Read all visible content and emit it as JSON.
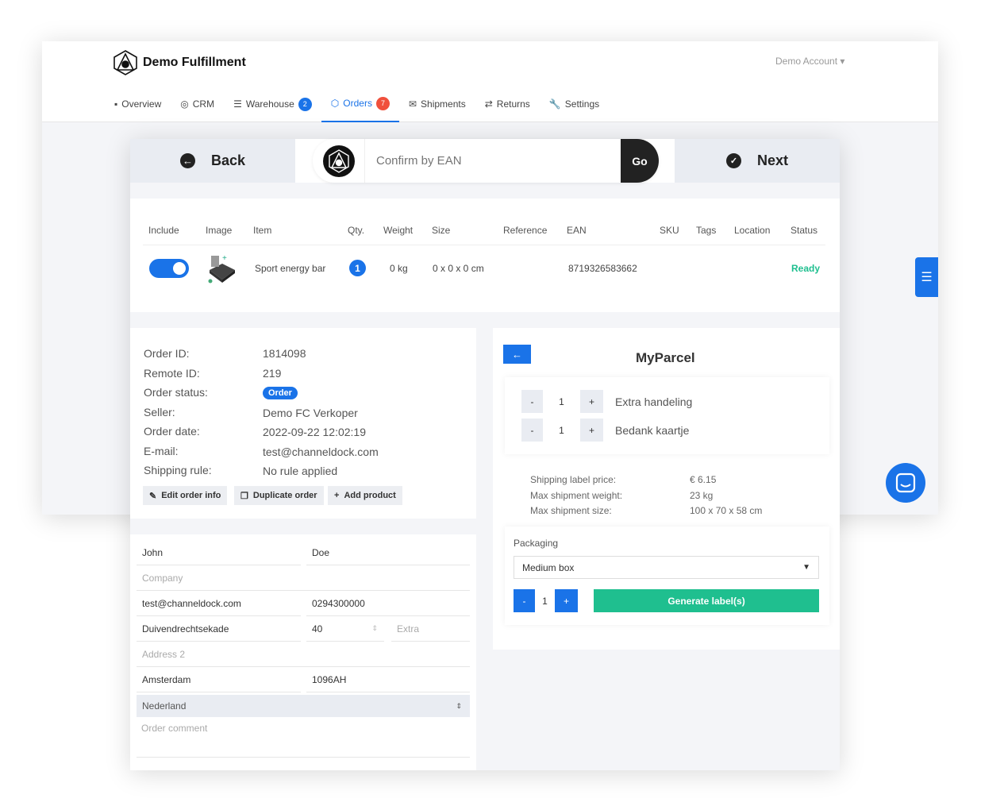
{
  "brand": {
    "name": "Demo Fulfillment"
  },
  "account": {
    "label": "Demo Account"
  },
  "nav": [
    {
      "label": "Overview",
      "icon": "grid-icon"
    },
    {
      "label": "CRM",
      "icon": "user-circle-icon"
    },
    {
      "label": "Warehouse",
      "icon": "list-icon",
      "badge": "2"
    },
    {
      "label": "Orders",
      "icon": "box-icon",
      "badge": "7",
      "active": true
    },
    {
      "label": "Shipments",
      "icon": "envelope-icon"
    },
    {
      "label": "Returns",
      "icon": "arrows-icon"
    },
    {
      "label": "Settings",
      "icon": "wrench-icon"
    }
  ],
  "colors": {
    "accent": "#1a73e8",
    "badge_blue": "#1a73e8",
    "badge_red": "#f0503c",
    "success": "#1fbf8f"
  },
  "toolbar": {
    "back": "Back",
    "next": "Next",
    "ean_placeholder": "Confirm by EAN",
    "go": "Go"
  },
  "table": {
    "headers": [
      "Include",
      "Image",
      "Item",
      "Qty.",
      "Weight",
      "Size",
      "Reference",
      "EAN",
      "SKU",
      "Tags",
      "Location",
      "Status"
    ],
    "rows": [
      {
        "include": true,
        "item": "Sport energy bar",
        "qty": "1",
        "weight": "0 kg",
        "size": "0 x 0 x 0 cm",
        "reference": "",
        "ean": "8719326583662",
        "sku": "",
        "tags": "",
        "location": "",
        "status": "Ready"
      }
    ]
  },
  "order": {
    "labels": [
      "Order ID:",
      "Remote ID:",
      "Order status:",
      "Seller:",
      "Order date:",
      "E-mail:",
      "Shipping rule:"
    ],
    "order_id": "1814098",
    "remote_id": "219",
    "status": "Order",
    "seller": "Demo FC Verkoper",
    "date": "2022-09-22 12:02:19",
    "email": "test@channeldock.com",
    "shipping_rule": "No rule applied",
    "buttons": {
      "edit": "Edit order info",
      "duplicate": "Duplicate order",
      "add": "Add product"
    }
  },
  "address": {
    "first_name": "John",
    "last_name": "Doe",
    "company_placeholder": "Company",
    "email": "test@channeldock.com",
    "phone": "0294300000",
    "street": "Duivendrechtsekade",
    "number": "40",
    "extra_placeholder": "Extra",
    "address2_placeholder": "Address 2",
    "city": "Amsterdam",
    "zip": "1096AH",
    "country": "Nederland",
    "comment_placeholder": "Order comment"
  },
  "carrier": {
    "name": "MyParcel",
    "options": [
      {
        "qty": "1",
        "label": "Extra handeling"
      },
      {
        "qty": "1",
        "label": "Bedank kaartje"
      }
    ],
    "info": [
      {
        "label": "Shipping label price:",
        "value": "€ 6.15"
      },
      {
        "label": "Max shipment weight:",
        "value": "23 kg"
      },
      {
        "label": "Max shipment size:",
        "value": "100 x 70 x 58 cm"
      }
    ],
    "packaging_label": "Packaging",
    "packaging": "Medium box",
    "label_qty": "1",
    "generate": "Generate label(s)"
  }
}
